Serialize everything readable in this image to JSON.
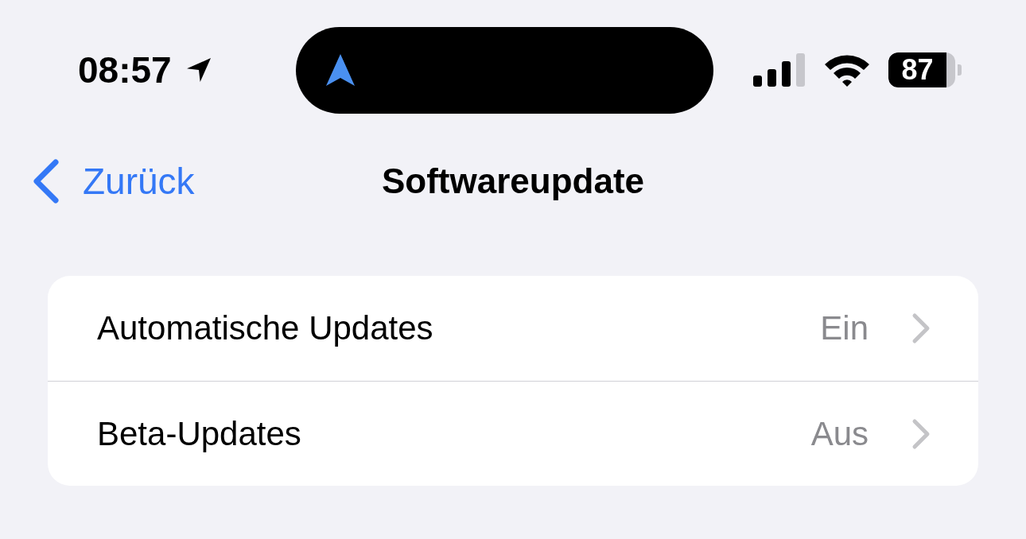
{
  "status_bar": {
    "time": "08:57",
    "battery": "87"
  },
  "nav": {
    "back": "Zurück",
    "title": "Softwareupdate"
  },
  "rows": [
    {
      "label": "Automatische Updates",
      "value": "Ein"
    },
    {
      "label": "Beta-Updates",
      "value": "Aus"
    }
  ]
}
